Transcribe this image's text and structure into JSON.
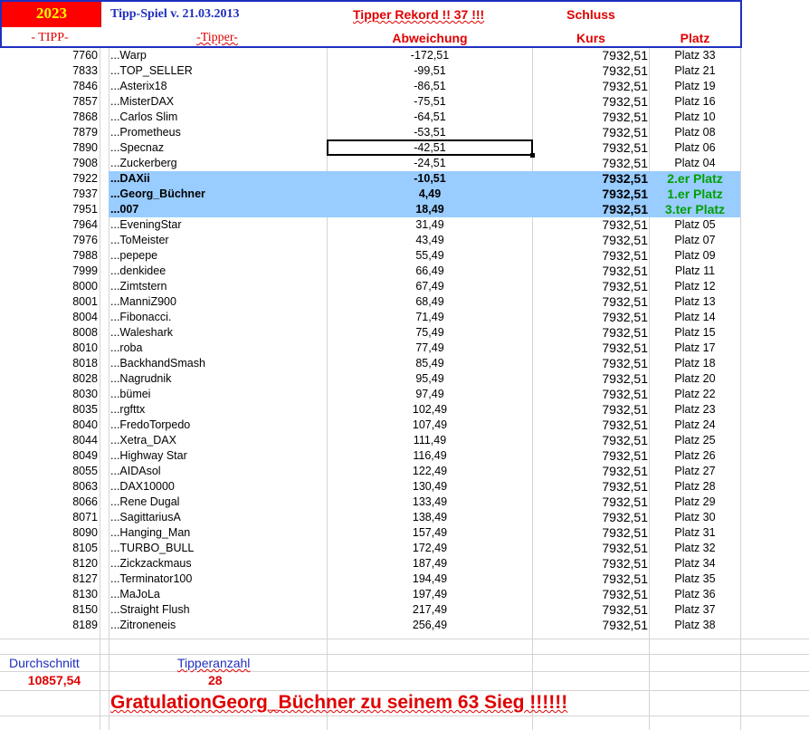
{
  "header": {
    "year": "2023",
    "title": "Tipp-Spiel v. 21.03.2013",
    "rekord": "Tipper Rekord !!  37  !!!",
    "schluss": "Schluss",
    "col_tipp": "- TIPP-",
    "col_tipper": "-Tipper-",
    "col_abweichung": "Abweichung",
    "col_kurs": "Kurs",
    "col_platz": "Platz"
  },
  "rows": [
    {
      "tipp": "7760",
      "name": "...Warp",
      "abw": "-172,51",
      "kurs": "7932,51",
      "platz": "Platz 33"
    },
    {
      "tipp": "7833",
      "name": "...TOP_SELLER",
      "abw": "-99,51",
      "kurs": "7932,51",
      "platz": "Platz 21"
    },
    {
      "tipp": "7846",
      "name": "...Asterix18",
      "abw": "-86,51",
      "kurs": "7932,51",
      "platz": "Platz 19"
    },
    {
      "tipp": "7857",
      "name": "...MisterDAX",
      "abw": "-75,51",
      "kurs": "7932,51",
      "platz": "Platz 16"
    },
    {
      "tipp": "7868",
      "name": "...Carlos Slim",
      "abw": "-64,51",
      "kurs": "7932,51",
      "platz": "Platz 10"
    },
    {
      "tipp": "7879",
      "name": "...Prometheus",
      "abw": "-53,51",
      "kurs": "7932,51",
      "platz": "Platz 08"
    },
    {
      "tipp": "7890",
      "name": "...Specnaz",
      "abw": "-42,51",
      "kurs": "7932,51",
      "platz": "Platz 06"
    },
    {
      "tipp": "7908",
      "name": "...Zuckerberg",
      "abw": "-24,51",
      "kurs": "7932,51",
      "platz": "Platz 04"
    },
    {
      "tipp": "7922",
      "name": "...DAXii",
      "abw": "-10,51",
      "kurs": "7932,51",
      "platz": "2.er Platz",
      "hl": true
    },
    {
      "tipp": "7937",
      "name": "...Georg_Büchner",
      "abw": "4,49",
      "kurs": "7932,51",
      "platz": "1.er Platz",
      "hl": true
    },
    {
      "tipp": "7951",
      "name": "...007",
      "abw": "18,49",
      "kurs": "7932,51",
      "platz": "3.ter Platz",
      "hl": true
    },
    {
      "tipp": "7964",
      "name": "...EveningStar",
      "abw": "31,49",
      "kurs": "7932,51",
      "platz": "Platz 05"
    },
    {
      "tipp": "7976",
      "name": "...ToMeister",
      "abw": "43,49",
      "kurs": "7932,51",
      "platz": "Platz 07"
    },
    {
      "tipp": "7988",
      "name": "...pepepe",
      "abw": "55,49",
      "kurs": "7932,51",
      "platz": "Platz 09"
    },
    {
      "tipp": "7999",
      "name": "...denkidee",
      "abw": "66,49",
      "kurs": "7932,51",
      "platz": "Platz 11"
    },
    {
      "tipp": "8000",
      "name": "...Zimtstern",
      "abw": "67,49",
      "kurs": "7932,51",
      "platz": "Platz 12"
    },
    {
      "tipp": "8001",
      "name": "...ManniZ900",
      "abw": "68,49",
      "kurs": "7932,51",
      "platz": "Platz 13"
    },
    {
      "tipp": "8004",
      "name": "...Fibonacci.",
      "abw": "71,49",
      "kurs": "7932,51",
      "platz": "Platz 14"
    },
    {
      "tipp": "8008",
      "name": "...Waleshark",
      "abw": "75,49",
      "kurs": "7932,51",
      "platz": "Platz 15"
    },
    {
      "tipp": "8010",
      "name": "...roba",
      "abw": "77,49",
      "kurs": "7932,51",
      "platz": "Platz 17"
    },
    {
      "tipp": "8018",
      "name": "...BackhandSmash",
      "abw": "85,49",
      "kurs": "7932,51",
      "platz": "Platz 18"
    },
    {
      "tipp": "8028",
      "name": "...Nagrudnik",
      "abw": "95,49",
      "kurs": "7932,51",
      "platz": "Platz 20"
    },
    {
      "tipp": "8030",
      "name": "...bümei",
      "abw": "97,49",
      "kurs": "7932,51",
      "platz": "Platz 22"
    },
    {
      "tipp": "8035",
      "name": "...rgfttx",
      "abw": "102,49",
      "kurs": "7932,51",
      "platz": "Platz 23"
    },
    {
      "tipp": "8040",
      "name": "...FredoTorpedo",
      "abw": "107,49",
      "kurs": "7932,51",
      "platz": "Platz 24"
    },
    {
      "tipp": "8044",
      "name": "...Xetra_DAX",
      "abw": "111,49",
      "kurs": "7932,51",
      "platz": "Platz 25"
    },
    {
      "tipp": "8049",
      "name": "...Highway Star",
      "abw": "116,49",
      "kurs": "7932,51",
      "platz": "Platz 26"
    },
    {
      "tipp": "8055",
      "name": "...AIDAsol",
      "abw": "122,49",
      "kurs": "7932,51",
      "platz": "Platz 27"
    },
    {
      "tipp": "8063",
      "name": "...DAX10000",
      "abw": "130,49",
      "kurs": "7932,51",
      "platz": "Platz 28"
    },
    {
      "tipp": "8066",
      "name": "...Rene Dugal",
      "abw": "133,49",
      "kurs": "7932,51",
      "platz": "Platz 29"
    },
    {
      "tipp": "8071",
      "name": "...SagittariusA",
      "abw": "138,49",
      "kurs": "7932,51",
      "platz": "Platz 30"
    },
    {
      "tipp": "8090",
      "name": "...Hanging_Man",
      "abw": "157,49",
      "kurs": "7932,51",
      "platz": "Platz 31"
    },
    {
      "tipp": "8105",
      "name": "...TURBO_BULL",
      "abw": "172,49",
      "kurs": "7932,51",
      "platz": "Platz 32"
    },
    {
      "tipp": "8120",
      "name": "...Zickzackmaus",
      "abw": "187,49",
      "kurs": "7932,51",
      "platz": "Platz 34"
    },
    {
      "tipp": "8127",
      "name": "...Terminator100",
      "abw": "194,49",
      "kurs": "7932,51",
      "platz": "Platz 35"
    },
    {
      "tipp": "8130",
      "name": "...MaJoLa",
      "abw": "197,49",
      "kurs": "7932,51",
      "platz": "Platz 36"
    },
    {
      "tipp": "8150",
      "name": "...Straight Flush",
      "abw": "217,49",
      "kurs": "7932,51",
      "platz": "Platz 37"
    },
    {
      "tipp": "8189",
      "name": "...Zitroneneis",
      "abw": "256,49",
      "kurs": "7932,51",
      "platz": "Platz 38"
    }
  ],
  "footer": {
    "avg_label": "Durchschnitt",
    "avg_value": "10857,54",
    "count_label": "Tipperanzahl",
    "count_value": "28",
    "congrats": "GratulationGeorg_Büchner  zu seinem 63 Sieg !!!!!!"
  },
  "colors": {
    "header_border": "#1f2fbf",
    "year_bg": "#ff0000",
    "year_text": "#ffff00",
    "highlight_bg": "#99ccff",
    "winner_text": "#00a000",
    "accent_red": "#e00000"
  }
}
